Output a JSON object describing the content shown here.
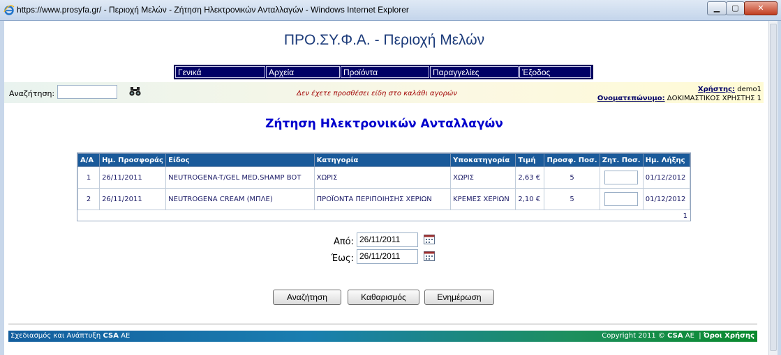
{
  "window": {
    "title": "https://www.prosyfa.gr/ - Περιοχή Μελών - Ζήτηση Ηλεκτρονικών Ανταλλαγών - Windows Internet Explorer"
  },
  "site_title": "ΠΡΟ.ΣΥ.Φ.Α. - Περιοχή Μελών",
  "menu": [
    "Γενικά",
    "Αρχεία",
    "Προϊόντα",
    "Παραγγελίες",
    "Έξοδος"
  ],
  "search": {
    "label": "Αναζήτηση:",
    "value": ""
  },
  "cart_message": "Δεν έχετε προσθέσει είδη στο καλάθι αγορών",
  "user": {
    "user_label": "Χρήστης:",
    "user_value": "demo1",
    "name_label": "Ονοματεπώνυμο:",
    "name_value": "ΔΟΚΙΜΑΣΤΙΚΟΣ ΧΡΗΣΤΗΣ 1"
  },
  "page_heading": "Ζήτηση Ηλεκτρονικών Ανταλλαγών",
  "table": {
    "columns": [
      "Α/Α",
      "Ημ. Προσφοράς",
      "Είδος",
      "Κατηγορία",
      "Υποκατηγορία",
      "Τιμή",
      "Προσφ. Ποσ.",
      "Ζητ. Ποσ.",
      "Ημ. Λήξης"
    ],
    "rows": [
      [
        "1",
        "26/11/2011",
        "NEUTROGENA-T/GEL MED.SHAMP BOT",
        "ΧΩΡΙΣ",
        "ΧΩΡΙΣ",
        "2,63 €",
        "5",
        "",
        "01/12/2012"
      ],
      [
        "2",
        "26/11/2011",
        "NEUTROGENA CREAM (ΜΠΛΕ)",
        "ΠΡΟΪΟΝΤΑ ΠΕΡΙΠΟΙΗΣΗΣ ΧΕΡΙΩΝ",
        "ΚΡΕΜΕΣ ΧΕΡΙΩΝ",
        "2,10 €",
        "5",
        "",
        "01/12/2012"
      ]
    ],
    "page": "1"
  },
  "filters": {
    "from_label": "Από:",
    "from_value": "26/11/2011",
    "to_label": "Έως:",
    "to_value": "26/11/2011"
  },
  "buttons": {
    "search": "Αναζήτηση",
    "clear": "Καθαρισμός",
    "update": "Ενημέρωση"
  },
  "footer": {
    "left_text": "Σχεδιασμός και Ανάπτυξη",
    "left_brand": "CSA",
    "left_suffix": "ΑΕ",
    "copyright": "Copyright 2011 ©",
    "right_brand": "CSA",
    "right_suffix": "ΑΕ",
    "terms": "Όροι Χρήσης"
  },
  "colors": {
    "menu_bg": "#000066",
    "header_row": "#1a5a9a",
    "heading": "#0000cc",
    "warning": "#a00000"
  }
}
